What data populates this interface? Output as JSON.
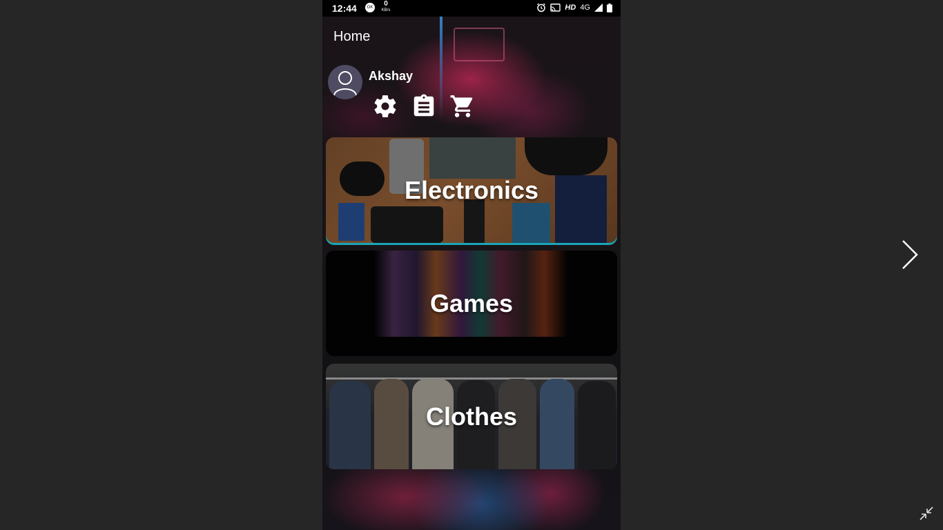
{
  "status_bar": {
    "time": "12:44",
    "net_badge": "OK",
    "data_speed": "0",
    "data_unit": "KB/s",
    "hd_label": "HD",
    "network_label": "4G"
  },
  "app": {
    "title": "Home"
  },
  "profile": {
    "username": "Akshay"
  },
  "quick_actions": [
    {
      "icon": "settings-icon"
    },
    {
      "icon": "clipboard-icon"
    },
    {
      "icon": "cart-icon"
    }
  ],
  "categories": [
    {
      "label": "Electronics"
    },
    {
      "label": "Games"
    },
    {
      "label": "Clothes"
    }
  ],
  "colors": {
    "viewer_background": "#262626",
    "status_bar": "#000000",
    "text": "#ffffff",
    "avatar": "#4e4b63",
    "card_accent": "#1aa6b8"
  }
}
